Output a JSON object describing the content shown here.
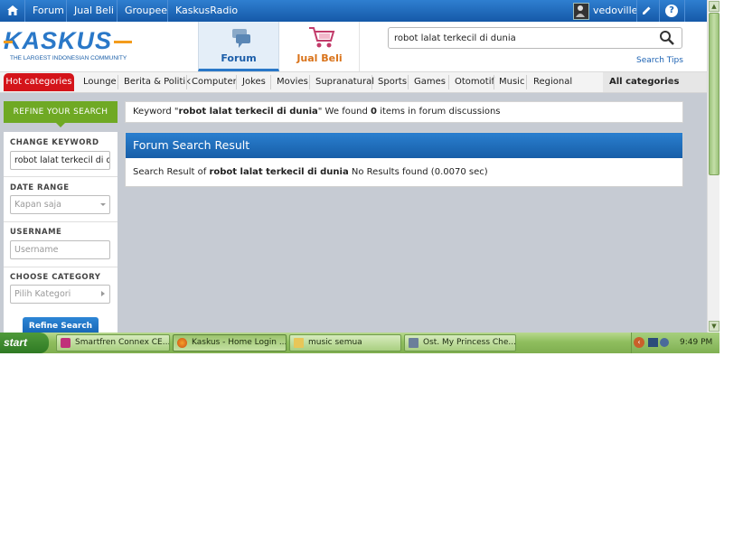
{
  "topnav": {
    "items": [
      "Forum",
      "Jual Beli",
      "Groupee",
      "KaskusRadio"
    ],
    "username": "vedoville"
  },
  "header": {
    "logo_text": "KASKUS",
    "logo_tagline": "THE LARGEST INDONESIAN COMMUNITY",
    "tabs": [
      {
        "label": "Forum"
      },
      {
        "label": "Jual Beli"
      }
    ],
    "search_value": "robot lalat terkecil di dunia",
    "search_tips": "Search Tips"
  },
  "categories": {
    "hot": "Hot categories",
    "items": [
      "Lounge",
      "Berita & Politik",
      "Computer",
      "Jokes",
      "Movies",
      "Supranatural",
      "Sports",
      "Games",
      "Otomotif",
      "Music",
      "Regional"
    ],
    "all": "All categories"
  },
  "refine": {
    "tag": "REFINE YOUR SEARCH",
    "keyword_prefix": "Keyword \"",
    "keyword": "robot lalat terkecil di dunia",
    "keyword_mid": "\" We found ",
    "count": "0",
    "keyword_suffix": " items in forum discussions"
  },
  "sidebar": {
    "change_keyword_label": "CHANGE KEYWORD",
    "change_keyword_value": "robot lalat terkecil di d",
    "date_range_label": "DATE RANGE",
    "date_range_value": "Kapan saja",
    "username_label": "USERNAME",
    "username_placeholder": "Username",
    "category_label": "CHOOSE CATEGORY",
    "category_value": "Pilih Kategori",
    "refine_button": "Refine Search"
  },
  "result": {
    "title": "Forum Search Result",
    "prefix": "Search Result of ",
    "query": "robot lalat terkecil di dunia",
    "suffix": " No Results found (0.0070 sec)"
  },
  "taskbar": {
    "start": "start",
    "tasks": [
      "Smartfren Connex CE...",
      "Kaskus - Home Login ...",
      "music semua",
      "Ost. My Princess Che..."
    ],
    "clock": "9:49 PM"
  },
  "colors": {
    "brand_blue": "#1a66b8",
    "hot_red": "#d4141a",
    "refine_green": "#6fa924",
    "jualbeli_orange": "#d9731a"
  }
}
